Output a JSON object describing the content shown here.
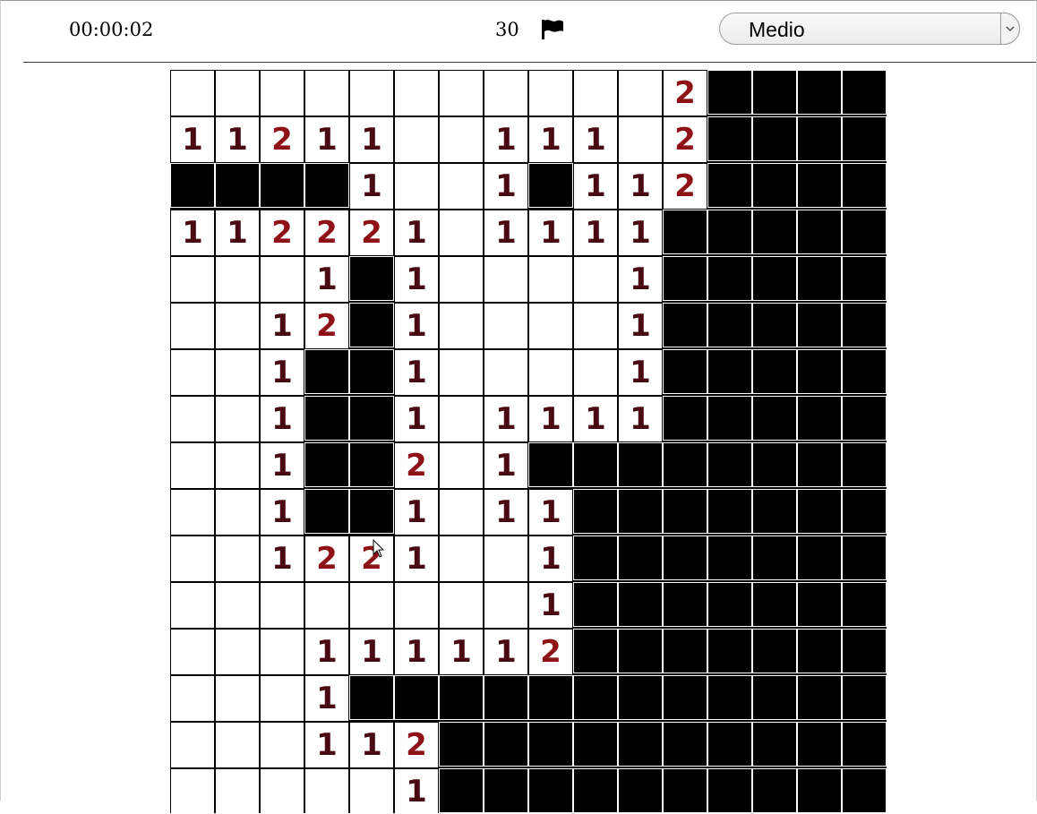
{
  "header": {
    "timer": "00:00:02",
    "mines_remaining": "30",
    "flag_icon": "flag-icon",
    "difficulty": {
      "selected": "Medio"
    }
  },
  "board": {
    "columns": 16,
    "rows_visible": 17,
    "legend": "H = unrevealed cell, 0 = revealed empty, digits = adjacent mine count",
    "rows": [
      [
        "0",
        "0",
        "0",
        "0",
        "0",
        "0",
        "0",
        "0",
        "0",
        "0",
        "0",
        "2",
        "H",
        "H",
        "H",
        "H"
      ],
      [
        "1",
        "1",
        "2",
        "1",
        "1",
        "0",
        "0",
        "1",
        "1",
        "1",
        "0",
        "2",
        "H",
        "H",
        "H",
        "H"
      ],
      [
        "H",
        "H",
        "H",
        "H",
        "1",
        "0",
        "0",
        "1",
        "H",
        "1",
        "1",
        "2",
        "H",
        "H",
        "H",
        "H"
      ],
      [
        "1",
        "1",
        "2",
        "2",
        "2",
        "1",
        "0",
        "1",
        "1",
        "1",
        "1",
        "H",
        "H",
        "H",
        "H",
        "H"
      ],
      [
        "0",
        "0",
        "0",
        "1",
        "H",
        "1",
        "0",
        "0",
        "0",
        "0",
        "1",
        "H",
        "H",
        "H",
        "H",
        "H"
      ],
      [
        "0",
        "0",
        "1",
        "2",
        "H",
        "1",
        "0",
        "0",
        "0",
        "0",
        "1",
        "H",
        "H",
        "H",
        "H",
        "H"
      ],
      [
        "0",
        "0",
        "1",
        "H",
        "H",
        "1",
        "0",
        "0",
        "0",
        "0",
        "1",
        "H",
        "H",
        "H",
        "H",
        "H"
      ],
      [
        "0",
        "0",
        "1",
        "H",
        "H",
        "1",
        "0",
        "1",
        "1",
        "1",
        "1",
        "H",
        "H",
        "H",
        "H",
        "H"
      ],
      [
        "0",
        "0",
        "1",
        "H",
        "H",
        "2",
        "0",
        "1",
        "H",
        "H",
        "H",
        "H",
        "H",
        "H",
        "H",
        "H"
      ],
      [
        "0",
        "0",
        "1",
        "H",
        "H",
        "1",
        "0",
        "1",
        "1",
        "H",
        "H",
        "H",
        "H",
        "H",
        "H",
        "H"
      ],
      [
        "0",
        "0",
        "1",
        "2",
        "2",
        "1",
        "0",
        "0",
        "1",
        "H",
        "H",
        "H",
        "H",
        "H",
        "H",
        "H"
      ],
      [
        "0",
        "0",
        "0",
        "0",
        "0",
        "0",
        "0",
        "0",
        "1",
        "H",
        "H",
        "H",
        "H",
        "H",
        "H",
        "H"
      ],
      [
        "0",
        "0",
        "0",
        "1",
        "1",
        "1",
        "1",
        "1",
        "2",
        "H",
        "H",
        "H",
        "H",
        "H",
        "H",
        "H"
      ],
      [
        "0",
        "0",
        "0",
        "1",
        "H",
        "H",
        "H",
        "H",
        "H",
        "H",
        "H",
        "H",
        "H",
        "H",
        "H",
        "H"
      ],
      [
        "0",
        "0",
        "0",
        "1",
        "1",
        "2",
        "H",
        "H",
        "H",
        "H",
        "H",
        "H",
        "H",
        "H",
        "H",
        "H"
      ],
      [
        "0",
        "0",
        "0",
        "0",
        "0",
        "1",
        "H",
        "H",
        "H",
        "H",
        "H",
        "H",
        "H",
        "H",
        "H",
        "H"
      ]
    ]
  },
  "colors": {
    "number_1": "#4a0a14",
    "number_2": "#8e1218",
    "hidden": "#000000",
    "revealed": "#ffffff"
  }
}
